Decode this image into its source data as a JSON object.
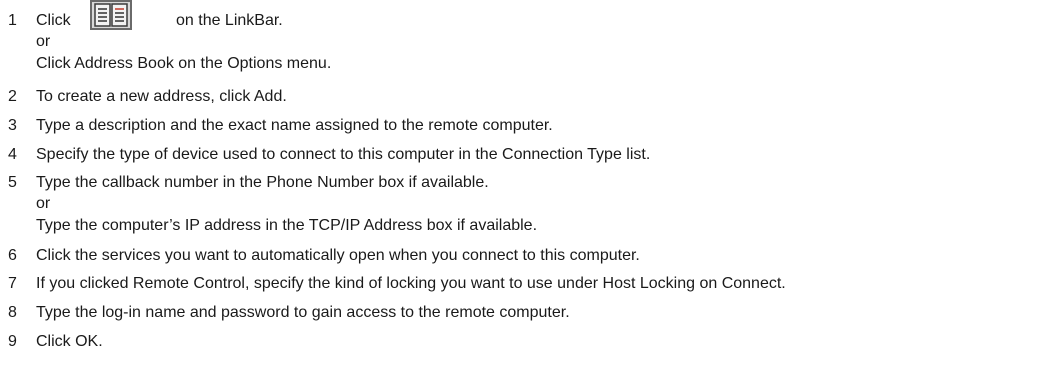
{
  "steps": [
    {
      "number": "1",
      "lines": [
        "Click",
        "on the LinkBar.",
        "or",
        "Click Address Book on the Options menu."
      ],
      "icon": "address-book-icon"
    },
    {
      "number": "2",
      "lines": [
        "To create a new address, click Add."
      ]
    },
    {
      "number": "3",
      "lines": [
        "Type a description and the exact name assigned to the remote computer."
      ]
    },
    {
      "number": "4",
      "lines": [
        "Specify the type of device used to connect to this computer in the Connection Type list."
      ]
    },
    {
      "number": "5",
      "lines": [
        "Type the callback number in the Phone Number box if available.",
        "or",
        "Type the computer’s IP address in the TCP/IP Address box if available."
      ]
    },
    {
      "number": "6",
      "lines": [
        "Click the services you want to automatically open when you connect to this computer."
      ]
    },
    {
      "number": "7",
      "lines": [
        "If you clicked Remote Control, specify the kind of locking you want to use under Host Locking on Connect."
      ]
    },
    {
      "number": "8",
      "lines": [
        "Type the log-in name and password to gain access to the remote computer."
      ]
    },
    {
      "number": "9",
      "lines": [
        "Click OK."
      ]
    }
  ]
}
